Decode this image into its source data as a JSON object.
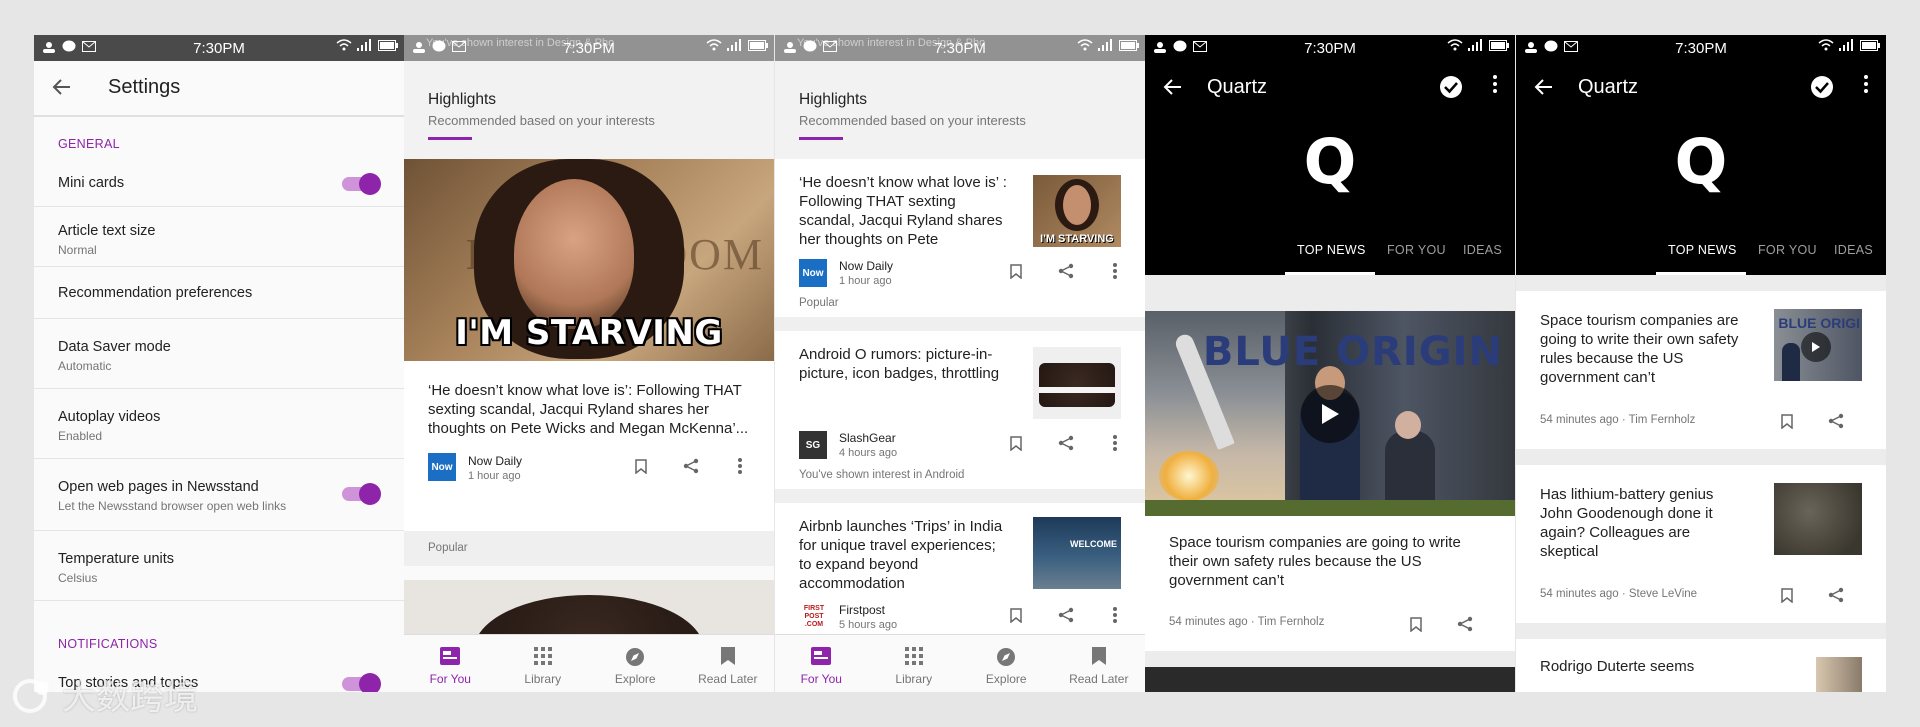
{
  "status_bar": {
    "time": "7:30PM"
  },
  "settings": {
    "title": "Settings",
    "section_general": "GENERAL",
    "section_notifications": "NOTIFICATIONS",
    "items": [
      {
        "title": "Mini cards",
        "subtitle": "",
        "toggle": true
      },
      {
        "title": "Article text size",
        "subtitle": "Normal"
      },
      {
        "title": "Recommendation preferences",
        "subtitle": ""
      },
      {
        "title": "Data Saver mode",
        "subtitle": "Automatic"
      },
      {
        "title": "Autoplay videos",
        "subtitle": "Enabled"
      },
      {
        "title": "Open web pages in Newsstand",
        "subtitle": "Let the Newsstand browser open web links",
        "toggle": true
      },
      {
        "title": "Temperature units",
        "subtitle": "Celsius"
      },
      {
        "title": "Top stories and topics",
        "subtitle": "",
        "toggle": true
      }
    ],
    "accent": "#8e24aa"
  },
  "newsstand": {
    "ghost_notification": "You've shown interest in Design & Pho",
    "highlights_title": "Highlights",
    "highlights_sub": "Recommended based on your interests",
    "meme_text": "I'M STARVING",
    "meme_bg_text": "DIARY ROOM",
    "story1": {
      "headline": "‘He doesn’t know what love is’: Following THAT sexting scandal, Jacqui Ryland shares her thoughts on Pete Wicks and Megan McKenna’...",
      "headline_short": "‘He doesn’t know what love is’ : Following THAT sexting scandal, Jacqui Ryland shares her thoughts on Pete",
      "source_badge": "Now",
      "source": "Now Daily",
      "time": "1 hour ago",
      "tag": "Popular"
    },
    "story2": {
      "headline": "Android O rumors: picture-in-picture, icon badges, throttling",
      "source_badge": "SG",
      "source": "SlashGear",
      "time": "4 hours ago",
      "tag": "You've shown interest in Android"
    },
    "story3": {
      "headline": "Airbnb launches ‘Trips’ in India for unique travel experiences; to expand beyond accommodation",
      "source_badge": "FIRST POST .COM",
      "source": "Firstpost",
      "time": "5 hours ago",
      "thumb_text": "WELCOME"
    },
    "nav": [
      "For You",
      "Library",
      "Explore",
      "Read Later"
    ],
    "tag_popular": "Popular"
  },
  "quartz": {
    "title": "Quartz",
    "logo": "Q",
    "tabs": [
      "TOP NEWS",
      "FOR YOU",
      "IDEAS"
    ],
    "hero_brand": "BLUE ORIGIN",
    "story1": {
      "headline": "Space tourism companies are going to write their own safety rules because the US government can’t",
      "meta": "54 minutes ago · Tim Fernholz"
    },
    "story2": {
      "headline": "Has lithium-battery genius John Goodenough done it again? Colleagues are skeptical",
      "meta": "54 minutes ago · Steve LeVine"
    },
    "story3": {
      "headline": "Rodrigo Duterte seems"
    }
  },
  "watermark": "大数跨境"
}
